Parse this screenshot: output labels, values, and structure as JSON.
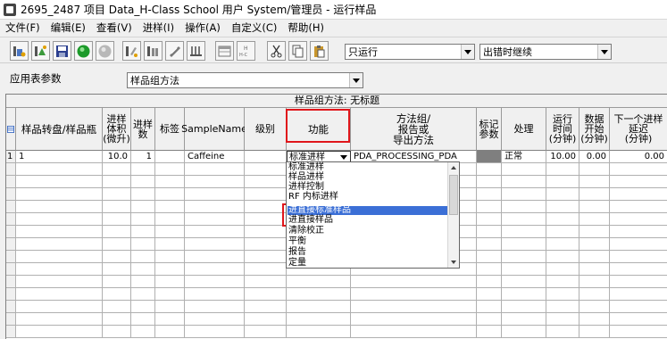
{
  "window": {
    "title": "2695_2487 项目 Data_H-Class School 用户 System/管理员 - 运行样品"
  },
  "menu": [
    {
      "label": "文件(F)"
    },
    {
      "label": "编辑(E)"
    },
    {
      "label": "查看(V)"
    },
    {
      "label": "进样(I)"
    },
    {
      "label": "操作(A)"
    },
    {
      "label": "自定义(C)"
    },
    {
      "label": "帮助(H)"
    }
  ],
  "toolbar": {
    "run_mode": "只运行",
    "error_mode": "出错时继续",
    "icons": [
      "run-single-icon",
      "run-sequence-icon",
      "save-icon",
      "start-icon",
      "stop-icon",
      "inject-icon",
      "vials-icon",
      "equilibrate-icon",
      "columns-icon",
      "table-icon",
      "h-ctrl-icon",
      "cut-icon",
      "copy-icon",
      "paste-icon"
    ]
  },
  "params": {
    "label": "应用表参数",
    "value": "样品组方法"
  },
  "grid": {
    "title": "样品组方法: 无标题",
    "headers": [
      "样品转盘/样品瓶",
      "进样\n体积\n(微升)",
      "进样\n数",
      "标签",
      "SampleName",
      "级别",
      "功能",
      "方法组/\n报告或\n导出方法",
      "标记\n参数",
      "处理",
      "运行\n时间\n(分钟)",
      "数据\n开始\n(分钟)",
      "下一个进样\n延迟\n(分钟)"
    ],
    "row": {
      "index": "1",
      "vial": "1",
      "volume": "10.0",
      "injections": "1",
      "label": "",
      "sample_name": "Caffeine",
      "level": "",
      "function": "标准进样",
      "method": "PDA_PROCESSING_PDA",
      "marker": "",
      "processing": "正常",
      "run_time": "10.00",
      "data_start": "0.00",
      "next_delay": "0.00"
    }
  },
  "function_dropdown": {
    "options": [
      "标准进样",
      "样品进样",
      "进样控制",
      "RF 内标进样",
      "进直接标准样品",
      "进直接样品",
      "清除校正",
      "平衡",
      "报告",
      "定量"
    ],
    "selected_index": 4
  },
  "colors": {
    "highlight": "#e0161b",
    "selection": "#3b6fd6",
    "marker_cell": "#7f7f7f"
  }
}
